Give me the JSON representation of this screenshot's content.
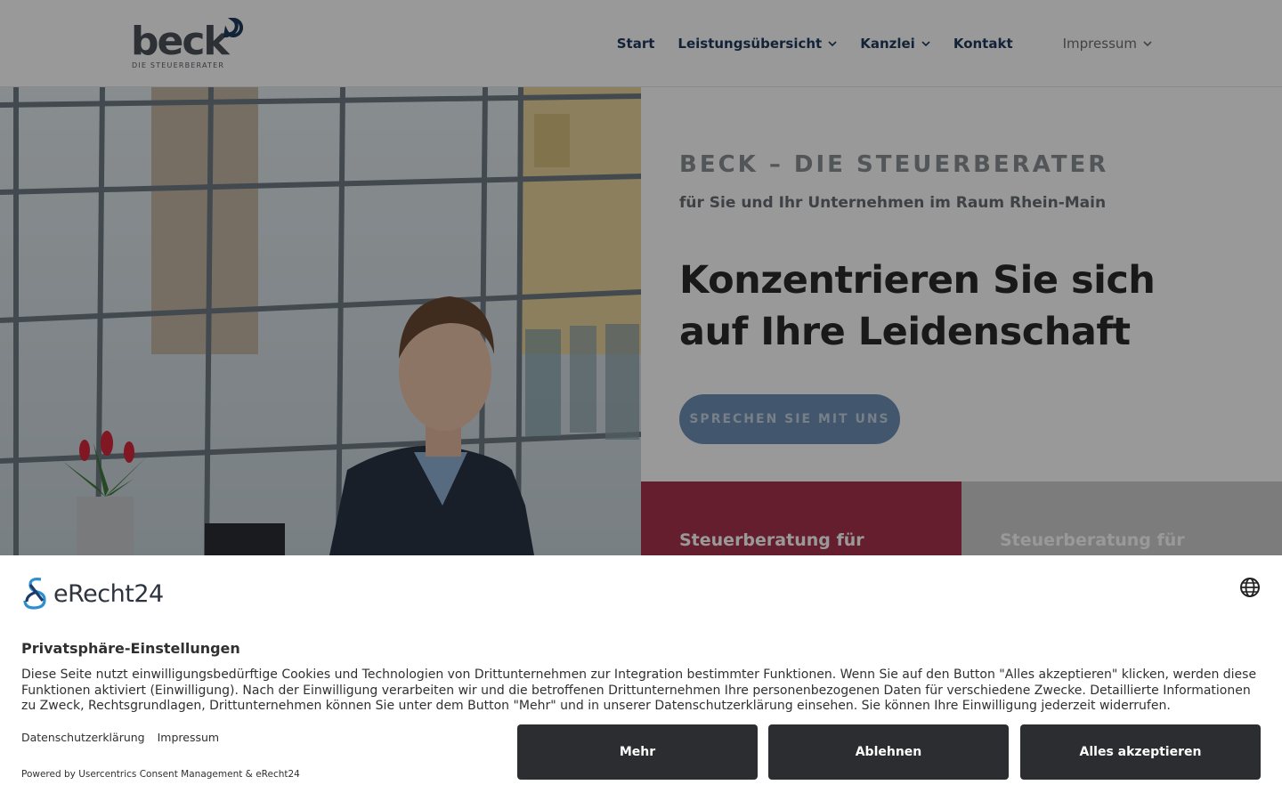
{
  "header": {
    "logo": {
      "word": "beck",
      "subtitle": "DIE STEUERBERATER"
    },
    "nav": [
      {
        "label": "Start",
        "has_dropdown": false
      },
      {
        "label": "Leistungsübersicht",
        "has_dropdown": true
      },
      {
        "label": "Kanzlei",
        "has_dropdown": true
      },
      {
        "label": "Kontakt",
        "has_dropdown": false
      },
      {
        "label": "Impressum",
        "has_dropdown": true
      }
    ]
  },
  "hero": {
    "eyebrow": "BECK – DIE STEUERBERATER",
    "eyebrow_sub": "für Sie und Ihr Unternehmen im Raum Rhein-Main",
    "headline": "Konzentrieren Sie sich auf Ihre Leidenschaft",
    "cta_label": "SPRECHEN SIE MIT UNS"
  },
  "tiles": [
    {
      "title": "Steuerberatung für"
    },
    {
      "title": "Steuerberatung für"
    }
  ],
  "consent": {
    "logo_text": "eRecht24",
    "title": "Privatsphäre-Einstellungen",
    "text": "Diese Seite nutzt einwilligungsbedürftige Cookies und Technologien von Drittunternehmen zur Integration bestimmter Funktionen. Wenn Sie auf den Button \"Alles akzeptieren\" klicken, werden diese Funktionen aktiviert (Einwilligung). Nach der Einwilligung verarbeiten wir und die betroffenen Drittunternehmen Ihre personenbezogenen Daten für verschiedene Zwecke. Detaillierte Informationen zu Zweck, Rechtsgrundlagen, Drittunternehmen können Sie unter dem Button \"Mehr\" und in unserer Datenschutzerklärung einsehen. Sie können Ihre Einwilligung jederzeit widerrufen.",
    "links": {
      "privacy": "Datenschutzerklärung",
      "imprint": "Impressum"
    },
    "powered_by": "Powered by Usercentrics Consent Management & eRecht24",
    "buttons": {
      "more": "Mehr",
      "deny": "Ablehnen",
      "accept_all": "Alles akzeptieren"
    }
  },
  "colors": {
    "nav_text": "#1f3a5c",
    "cta_bg": "#6e8fb6",
    "tile_red": "#a8334b",
    "tile_grey": "#cfcfcf",
    "consent_button": "#2b2d31",
    "erecht_blue": "#2b8fd0"
  },
  "icons": [
    "chevron-down-icon",
    "globe-icon",
    "logo-mark-icon"
  ]
}
